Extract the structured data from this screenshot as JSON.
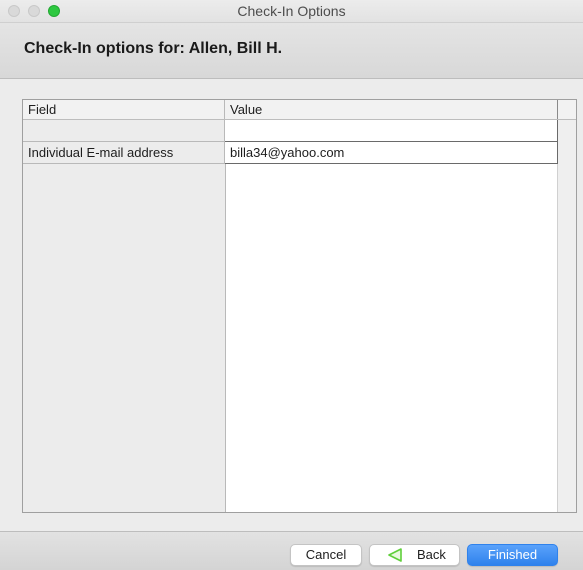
{
  "window": {
    "title": "Check-In Options"
  },
  "header": {
    "title": "Check-In options for: Allen, Bill H."
  },
  "grid": {
    "columns": [
      "Field",
      "Value"
    ],
    "rows": [
      {
        "field": "",
        "value": ""
      },
      {
        "field": "Individual E-mail address",
        "value": "billa34@yahoo.com"
      }
    ]
  },
  "buttons": {
    "cancel": "Cancel",
    "back": "Back",
    "finished": "Finished"
  },
  "icons": {
    "back": "back-arrow-icon"
  },
  "colors": {
    "accent": "#2f82ec",
    "zoom_button": "#2dc840",
    "back_icon": "#5fcf3a"
  }
}
